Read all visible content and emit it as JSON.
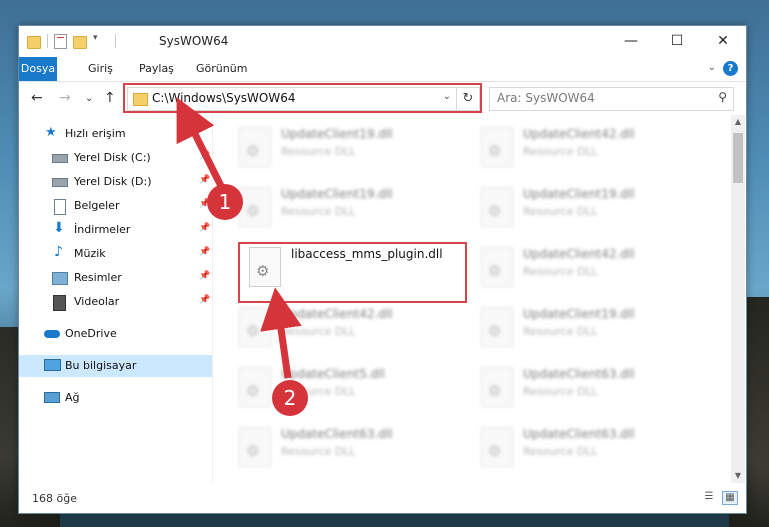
{
  "window": {
    "title": "SysWOW64",
    "minimize": "—",
    "maximize": "☐",
    "close": "✕"
  },
  "ribbon": {
    "tabs": [
      "Dosya",
      "Giriş",
      "Paylaş",
      "Görünüm"
    ],
    "help": "?",
    "collapse": "⌄"
  },
  "nav": {
    "back": "←",
    "forward": "→",
    "recent": "⌄",
    "up": "↑"
  },
  "address": {
    "path": "C:\\Windows\\SysWOW64",
    "dropdown": "⌄",
    "refresh": "↻"
  },
  "search": {
    "placeholder": "Ara: SysWOW64",
    "icon": "⚲"
  },
  "sidebar": {
    "items": [
      {
        "label": "Hızlı erişim",
        "icon": "star-icon"
      },
      {
        "label": "Yerel Disk (C:)",
        "icon": "drive-icon"
      },
      {
        "label": "Yerel Disk (D:)",
        "icon": "drive-icon"
      },
      {
        "label": "Belgeler",
        "icon": "documents-icon"
      },
      {
        "label": "İndirmeler",
        "icon": "download-icon"
      },
      {
        "label": "Müzik",
        "icon": "music-icon"
      },
      {
        "label": "Resimler",
        "icon": "pictures-icon"
      },
      {
        "label": "Videolar",
        "icon": "video-icon"
      },
      {
        "label": "OneDrive",
        "icon": "cloud-icon"
      },
      {
        "label": "Bu bilgisayar",
        "icon": "computer-icon"
      },
      {
        "label": "Ağ",
        "icon": "network-icon"
      }
    ]
  },
  "files": [
    {
      "name": "UpdateClient19.dll",
      "type": "Resource DLL"
    },
    {
      "name": "UpdateClient42.dll",
      "type": "Resource DLL"
    },
    {
      "name": "UpdateClient19.dll",
      "type": "Resource DLL"
    },
    {
      "name": "UpdateClient19.dll",
      "type": "Resource DLL"
    },
    {
      "name": "libaccess_mms_plugin.dll",
      "type": ""
    },
    {
      "name": "UpdateClient42.dll",
      "type": "Resource DLL"
    },
    {
      "name": "UpdateClient42.dll",
      "type": "Resource DLL"
    },
    {
      "name": "UpdateClient19.dll",
      "type": "Resource DLL"
    },
    {
      "name": "UpdateClient5.dll",
      "type": "Resource DLL"
    },
    {
      "name": "UpdateClient63.dll",
      "type": "Resource DLL"
    },
    {
      "name": "UpdateClient63.dll",
      "type": "Resource DLL"
    },
    {
      "name": "UpdateClient63.dll",
      "type": "Resource DLL"
    }
  ],
  "status": {
    "count": "168 öğe"
  },
  "callouts": [
    "1",
    "2"
  ],
  "colors": {
    "accent": "#1979ca",
    "highlight": "#d9434a",
    "selected": "#cce8ff"
  }
}
